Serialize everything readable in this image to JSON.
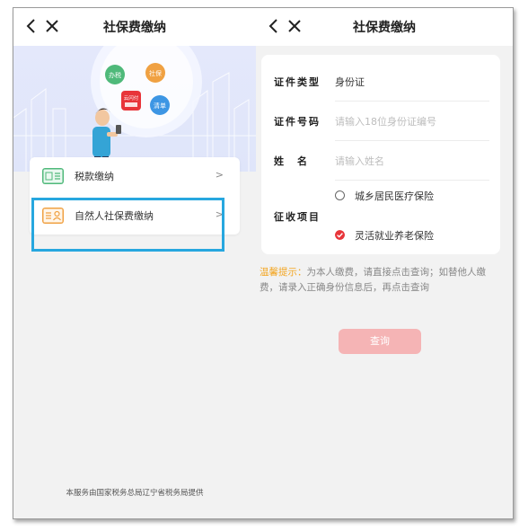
{
  "left": {
    "title": "社保费缴纳",
    "banner": {
      "bubbles": [
        "办税",
        "社保",
        "清单"
      ],
      "app_badge": "云闪付"
    },
    "menu": [
      {
        "label": "税款缴纳",
        "arrow": ">"
      },
      {
        "label": "自然人社保费缴纳",
        "arrow": ">"
      }
    ],
    "footer": "本服务由国家税务总局辽宁省税务局提供"
  },
  "right": {
    "title": "社保费缴纳",
    "form": {
      "id_type_label": "证件类型",
      "id_type_value": "身份证",
      "id_number_label": "证件号码",
      "id_number_placeholder": "请输入18位身份证编号",
      "name_label": "姓　名",
      "name_placeholder": "请输入姓名",
      "item_label": "征收项目",
      "options": [
        {
          "label": "城乡居民医疗保险",
          "selected": false
        },
        {
          "label": "灵活就业养老保险",
          "selected": true
        }
      ]
    },
    "tip_head": "温馨提示：",
    "tip_body": "为本人缴费，请直接点击查询；如替他人缴费，请录入正确身份信息后，再点击查询",
    "query_button": "查询"
  },
  "colors": {
    "accent_red": "#e8353a",
    "tip_orange": "#f3a623",
    "highlight_blue": "#27a7df",
    "button_disabled": "#f5b4b5"
  }
}
